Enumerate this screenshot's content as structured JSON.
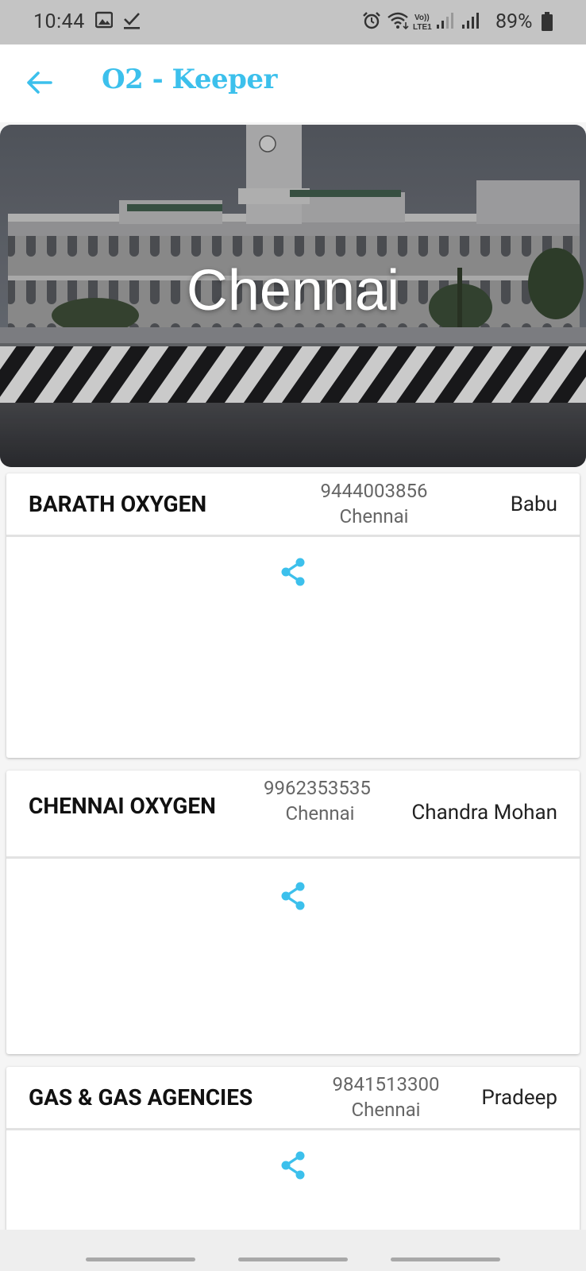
{
  "status_bar": {
    "time": "10:44",
    "battery": "89%",
    "icons": [
      "gallery-icon",
      "check-icon",
      "alarm-icon",
      "wifi-icon",
      "volte-icon",
      "signal-icon",
      "signal-icon",
      "battery-icon"
    ]
  },
  "app_bar": {
    "title": "O2 - Keeper",
    "back_icon": "arrow-left-icon",
    "accent_color": "#3cc0ec"
  },
  "hero": {
    "city": "Chennai"
  },
  "suppliers": [
    {
      "name": "BARATH OXYGEN",
      "phone": "9444003856",
      "city": "Chennai",
      "contact": "Babu"
    },
    {
      "name": "CHENNAI OXYGEN",
      "phone": "9962353535",
      "city": "Chennai",
      "contact": "Chandra Mohan"
    },
    {
      "name": "GAS & GAS AGENCIES",
      "phone": "9841513300",
      "city": "Chennai",
      "contact": "Pradeep"
    }
  ],
  "share_icon": "share-icon"
}
